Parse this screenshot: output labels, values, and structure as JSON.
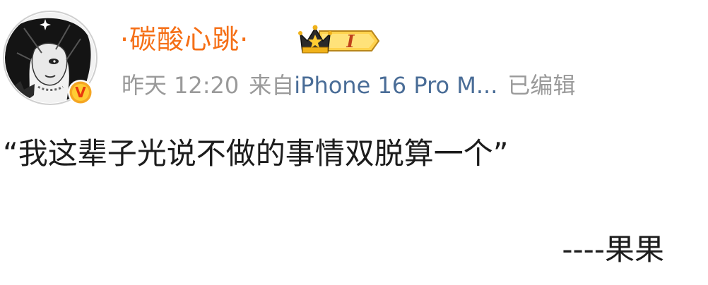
{
  "post": {
    "username": "·碳酸心跳·",
    "badge_level": "I",
    "verified_mark": "V",
    "date": "昨天",
    "time": "12:20",
    "from_label": "来自",
    "device": "iPhone 16 Pro M...",
    "edited_label": "已编辑",
    "content": "“我这辈子光说不做的事情双脱算一个”",
    "signature": "----果果"
  },
  "colors": {
    "username": "#f56f16",
    "meta_gray": "#9a9a9a",
    "device_blue": "#4a6d97",
    "verified_bg": "#f5a623",
    "verified_letter": "#e8380d"
  },
  "icons": {
    "avatar": "avatar-image",
    "verified": "verified-v-icon",
    "badge": "crown-level-badge-icon"
  }
}
